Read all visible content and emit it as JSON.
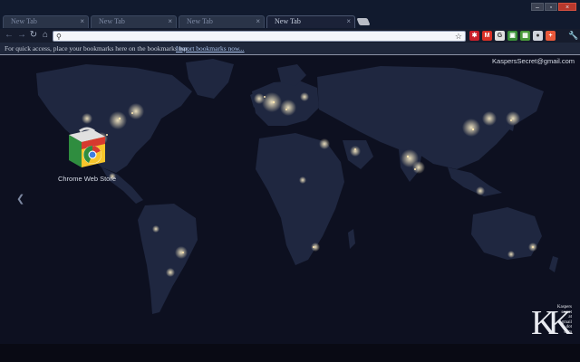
{
  "tabs": [
    {
      "title": "New Tab",
      "close": "×",
      "active": false
    },
    {
      "title": "New Tab",
      "close": "×",
      "active": false
    },
    {
      "title": "New Tab",
      "close": "×",
      "active": false
    },
    {
      "title": "New Tab",
      "close": "×",
      "active": true
    }
  ],
  "window_controls": {
    "minimize": "–",
    "maximize": "▫",
    "close": "×"
  },
  "toolbar": {
    "back": "←",
    "forward": "→",
    "reload": "↻",
    "home": "⌂",
    "omnibox_value": "",
    "omnibox_placeholder": "",
    "search_glyph": "⚲",
    "star": "☆",
    "wrench": "🔧",
    "extensions": [
      {
        "name": "gmail-checker-icon",
        "glyph": "✱",
        "color": "#c8202a"
      },
      {
        "name": "gmail-notifier-icon",
        "glyph": "M",
        "color": "#d93025"
      },
      {
        "name": "google-plus-notifier-icon",
        "glyph": "G",
        "color": "#e0e0e0"
      },
      {
        "name": "screenshot-extension-icon",
        "glyph": "▣",
        "color": "#3a8f3a"
      },
      {
        "name": "image-extension-icon",
        "glyph": "▦",
        "color": "#4a9a3c"
      },
      {
        "name": "translate-extension-icon",
        "glyph": "●",
        "color": "#d0d4dc"
      },
      {
        "name": "addon-extension-icon",
        "glyph": "+",
        "color": "#e8583a"
      }
    ]
  },
  "bookmarks": {
    "prompt": "For quick access, place your bookmarks here on the bookmarks bar.",
    "import_link": "Import bookmarks now..."
  },
  "page": {
    "account": "KaspersSecret@gmail.com",
    "apps": [
      {
        "label": "Chrome Web Store",
        "icon": "chrome-web-store-icon"
      }
    ],
    "prev_arrow": "❮",
    "watermark": {
      "letters": "KK",
      "text_lines": [
        "Kaspers",
        "secret",
        "at",
        "gmail",
        "dot",
        "com"
      ]
    }
  },
  "colors": {
    "frame": "#111a2e",
    "toolbar": "#161c2d",
    "bookmark_bar": "#1f273b",
    "ocean": "#0d1020",
    "land": "#1f2740",
    "city_lights": "#f2d9a0"
  }
}
